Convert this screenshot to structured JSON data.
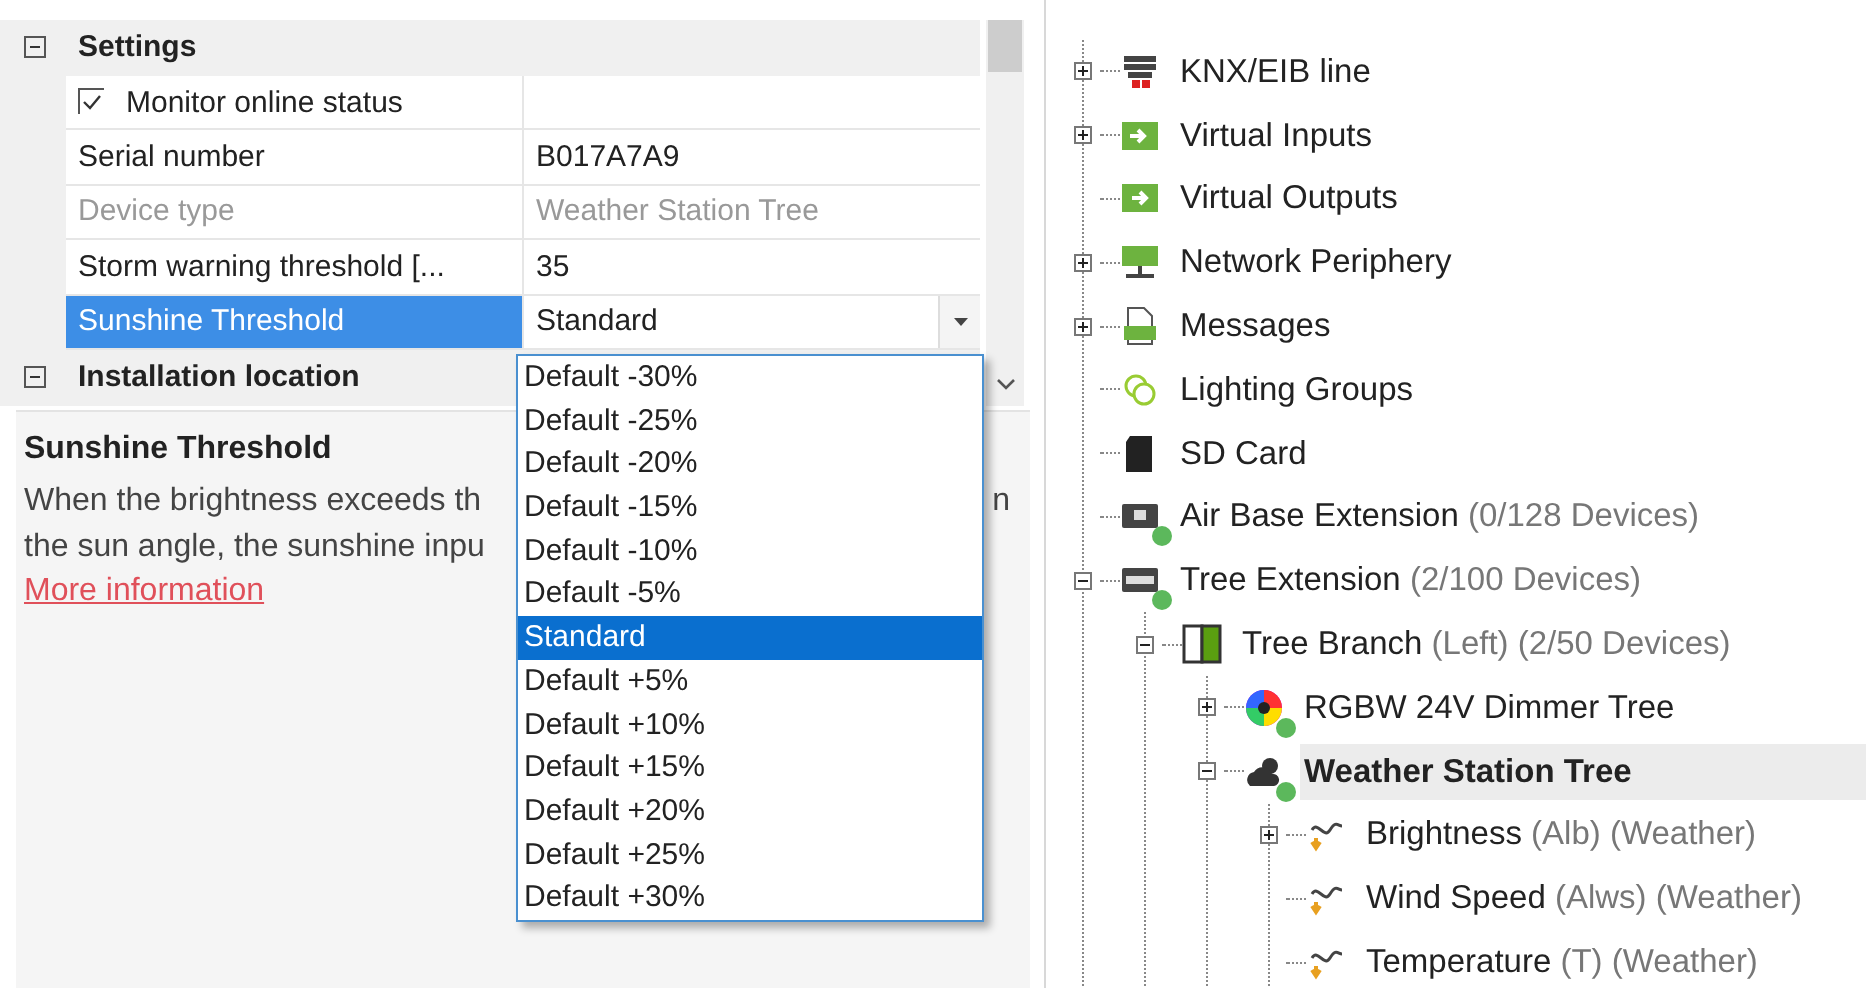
{
  "property_grid": {
    "categories": [
      {
        "label": "Settings",
        "expanded": true,
        "rows": [
          {
            "kind": "check",
            "label": "Monitor online status",
            "checked": true,
            "disabled": false,
            "selected": false
          },
          {
            "kind": "text",
            "label": "Serial number",
            "value": "B017A7A9",
            "disabled": false,
            "selected": false
          },
          {
            "kind": "text",
            "label": "Device type",
            "value": "Weather Station Tree",
            "disabled": true,
            "selected": false
          },
          {
            "kind": "text",
            "label": "Storm warning threshold [...",
            "value": "35",
            "disabled": false,
            "selected": false
          },
          {
            "kind": "dropdown",
            "label": "Sunshine Threshold",
            "value": "Standard",
            "disabled": false,
            "selected": true
          }
        ]
      },
      {
        "label": "Installation location",
        "expanded": true
      }
    ]
  },
  "dropdown_list": {
    "options": [
      {
        "label": "Default -30%",
        "selected": false
      },
      {
        "label": "Default -25%",
        "selected": false
      },
      {
        "label": "Default -20%",
        "selected": false
      },
      {
        "label": "Default -15%",
        "selected": false
      },
      {
        "label": "Default -10%",
        "selected": false
      },
      {
        "label": "Default -5%",
        "selected": false
      },
      {
        "label": "Standard",
        "selected": true
      },
      {
        "label": "Default +5%",
        "selected": false
      },
      {
        "label": "Default +10%",
        "selected": false
      },
      {
        "label": "Default +15%",
        "selected": false
      },
      {
        "label": "Default +20%",
        "selected": false
      },
      {
        "label": "Default +25%",
        "selected": false
      },
      {
        "label": "Default +30%",
        "selected": false
      }
    ]
  },
  "description": {
    "title": "Sunshine Threshold",
    "lines": [
      {
        "text": "When the brightness exceeds th",
        "tail": "n"
      },
      {
        "text": "the sun angle, the sunshine inpu"
      }
    ],
    "link": "More information"
  },
  "tree": {
    "items": [
      {
        "kind": "knx",
        "label": "KNX/EIB line",
        "expandable": true,
        "expanded": false,
        "selected": false
      },
      {
        "kind": "input",
        "label": "Virtual Inputs",
        "expandable": true,
        "expanded": false,
        "selected": false
      },
      {
        "kind": "output",
        "label": "Virtual Outputs",
        "expandable": false,
        "selected": false
      },
      {
        "kind": "network",
        "label": "Network Periphery",
        "expandable": true,
        "expanded": false,
        "selected": false
      },
      {
        "kind": "log",
        "label": "Messages",
        "expandable": true,
        "expanded": false,
        "selected": false
      },
      {
        "kind": "lighting",
        "label": "Lighting Groups",
        "expandable": false,
        "selected": false
      },
      {
        "kind": "sdcard",
        "label": "SD Card",
        "expandable": false,
        "selected": false
      },
      {
        "kind": "base",
        "label": "Air Base Extension",
        "detail": "(0/128 Devices)",
        "online": true,
        "expandable": false,
        "selected": false
      },
      {
        "kind": "extension",
        "label": "Tree Extension",
        "detail": "(2/100 Devices)",
        "online": true,
        "expandable": true,
        "expanded": true,
        "selected": false,
        "children": [
          {
            "kind": "branch",
            "label": "Tree Branch",
            "detail": "(Left) (2/50 Devices)",
            "expandable": true,
            "expanded": true,
            "selected": false,
            "children": [
              {
                "kind": "rgbw",
                "label": "RGBW 24V Dimmer Tree",
                "online": true,
                "expandable": true,
                "expanded": false,
                "selected": false
              },
              {
                "kind": "weather",
                "label": "Weather Station Tree",
                "online": true,
                "expandable": true,
                "expanded": true,
                "selected": true,
                "children": [
                  {
                    "kind": "sensor",
                    "label": "Brightness",
                    "detail": "(Alb) (Weather)",
                    "expandable": true,
                    "expanded": false,
                    "selected": false
                  },
                  {
                    "kind": "sensor",
                    "label": "Wind Speed",
                    "detail": "(Alws) (Weather)",
                    "expandable": false,
                    "selected": false
                  },
                  {
                    "kind": "sensor",
                    "label": "Temperature",
                    "detail": "(T) (Weather)",
                    "expandable": false,
                    "selected": false
                  }
                ]
              }
            ]
          }
        ]
      }
    ]
  }
}
